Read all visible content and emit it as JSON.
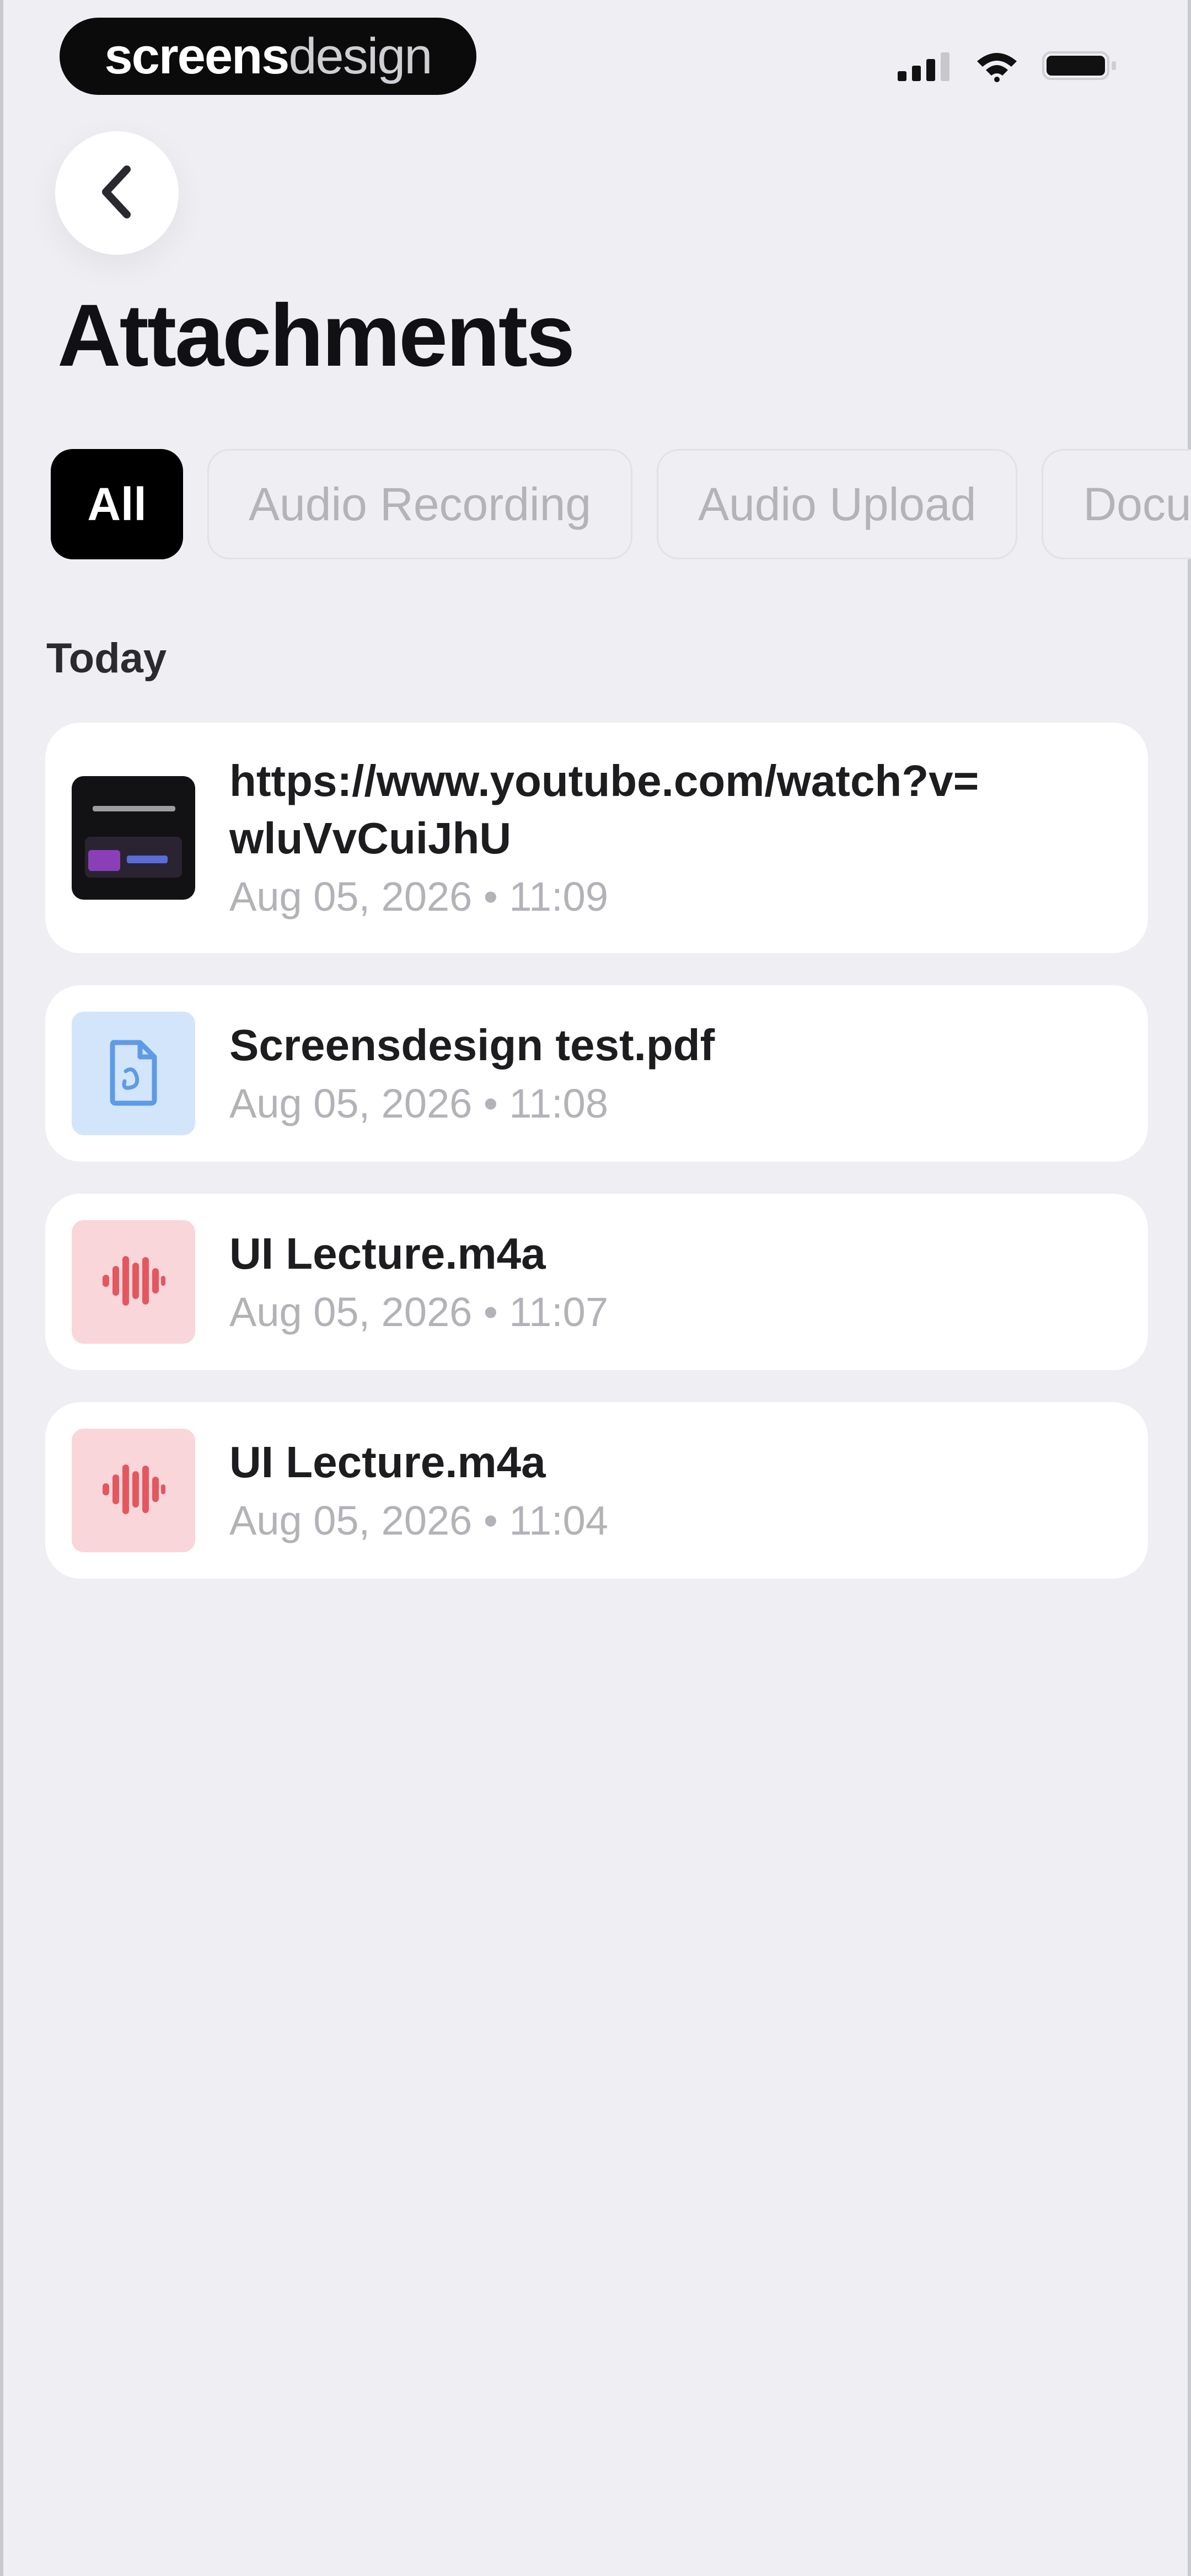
{
  "logo": {
    "bold_part": "screens",
    "light_part": "design"
  },
  "icons": {
    "back": "chevron-left-icon",
    "signal": "cellular-signal-icon",
    "wifi": "wifi-icon",
    "battery": "battery-icon",
    "pdf": "document-icon",
    "audio": "waveform-icon"
  },
  "colors": {
    "background": "#EEEEF3",
    "active_chip": "#000000",
    "pdf_tile": "#D3E5FB",
    "pdf_icon": "#5E9BE6",
    "audio_tile": "#F9D6DA",
    "audio_icon": "#E4575F"
  },
  "header": {
    "title": "Attachments"
  },
  "filters": {
    "active": "All",
    "items": [
      {
        "label": "All"
      },
      {
        "label": "Audio Recording"
      },
      {
        "label": "Audio Upload"
      },
      {
        "label": "Documents"
      }
    ]
  },
  "sections": [
    {
      "label": "Today",
      "items": [
        {
          "type": "video",
          "title": "https://www.youtube.com/watch?v=wluVvCuiJhU",
          "meta": "Aug 05, 2026 • 11:09"
        },
        {
          "type": "pdf",
          "title": "Screensdesign test.pdf",
          "meta": "Aug 05, 2026 • 11:08"
        },
        {
          "type": "audio",
          "title": "UI Lecture.m4a",
          "meta": "Aug 05, 2026 • 11:07"
        },
        {
          "type": "audio",
          "title": "UI Lecture.m4a",
          "meta": "Aug 05, 2026 • 11:04"
        }
      ]
    }
  ]
}
